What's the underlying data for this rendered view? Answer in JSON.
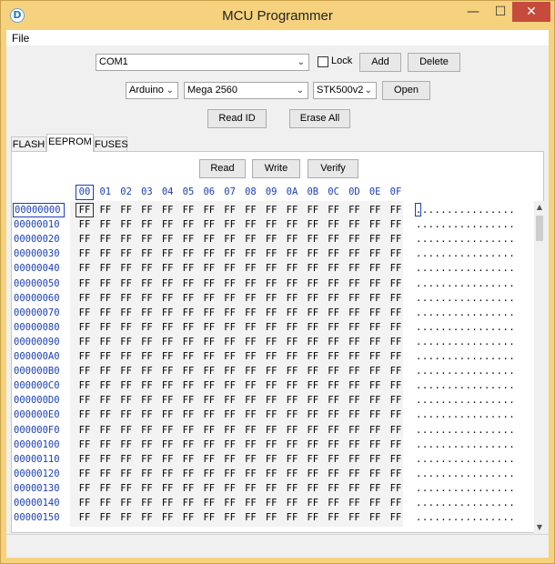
{
  "window": {
    "title": "MCU Programmer",
    "app_icon": "D",
    "minimize": "—",
    "maximize": "☐",
    "close": "✕"
  },
  "menu": {
    "file": "File"
  },
  "connection": {
    "port": "COM1",
    "lock_label": "Lock",
    "lock_checked": false,
    "add_label": "Add",
    "delete_label": "Delete"
  },
  "device": {
    "platform": "Arduino",
    "board": "Mega 2560",
    "protocol": "STK500v2",
    "open_label": "Open"
  },
  "actions": {
    "read_id_label": "Read ID",
    "erase_all_label": "Erase All"
  },
  "tabs": [
    {
      "label": "FLASH",
      "active": false
    },
    {
      "label": "EEPROM",
      "active": true
    },
    {
      "label": "FUSES",
      "active": false
    }
  ],
  "eeprom": {
    "read_label": "Read",
    "write_label": "Write",
    "verify_label": "Verify",
    "columns": [
      "00",
      "01",
      "02",
      "03",
      "04",
      "05",
      "06",
      "07",
      "08",
      "09",
      "0A",
      "0B",
      "0C",
      "0D",
      "0E",
      "0F"
    ],
    "addresses": [
      "00000000",
      "00000010",
      "00000020",
      "00000030",
      "00000040",
      "00000050",
      "00000060",
      "00000070",
      "00000080",
      "00000090",
      "000000A0",
      "000000B0",
      "000000C0",
      "000000D0",
      "000000E0",
      "000000F0",
      "00000100",
      "00000110",
      "00000120",
      "00000130",
      "00000140",
      "00000150"
    ],
    "cell_value": "FF",
    "ascii_row": "................"
  },
  "icons": {
    "dropdown": "chevron-down-icon",
    "scroll_up": "arrow-up-icon",
    "scroll_down": "arrow-down-icon"
  },
  "colors": {
    "frame": "#f6d27e",
    "address_blue": "#1a3fb5",
    "close_red": "#c74b3d"
  }
}
